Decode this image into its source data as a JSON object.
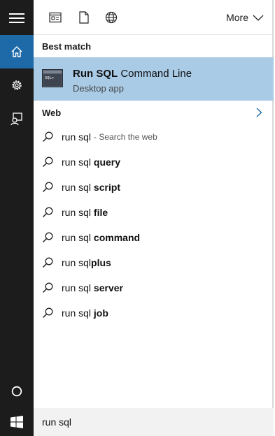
{
  "rail": {
    "items": [
      {
        "icon": "hamburger-menu-icon"
      },
      {
        "icon": "home-icon"
      },
      {
        "icon": "settings-gear-icon"
      },
      {
        "icon": "feedback-icon"
      },
      {
        "icon": "cortana-circle-icon"
      }
    ],
    "taskbar_icon": "windows-start-icon",
    "active_color": "#1e6aa8"
  },
  "toolbar": {
    "filters": [
      "apps-filter-icon",
      "documents-filter-icon",
      "web-filter-icon"
    ],
    "more_label": "More"
  },
  "best_match": {
    "section_label": "Best match",
    "app_icon_text": "SQL>",
    "title_bold": "Run SQL",
    "title_rest": " Command Line",
    "subtitle": "Desktop app",
    "highlight_color": "#a9cbe6"
  },
  "web": {
    "section_label": "Web",
    "suggestions": [
      {
        "prefix": "run sql",
        "bold": "",
        "hint": "- Search the web"
      },
      {
        "prefix": "run sql ",
        "bold": "query",
        "hint": ""
      },
      {
        "prefix": "run sql ",
        "bold": "script",
        "hint": ""
      },
      {
        "prefix": "run sql ",
        "bold": "file",
        "hint": ""
      },
      {
        "prefix": "run sql ",
        "bold": "command",
        "hint": ""
      },
      {
        "prefix": "run sql",
        "bold": "plus",
        "hint": ""
      },
      {
        "prefix": "run sql ",
        "bold": "server",
        "hint": ""
      },
      {
        "prefix": "run sql ",
        "bold": "job",
        "hint": ""
      }
    ]
  },
  "search": {
    "value": "run sql"
  }
}
